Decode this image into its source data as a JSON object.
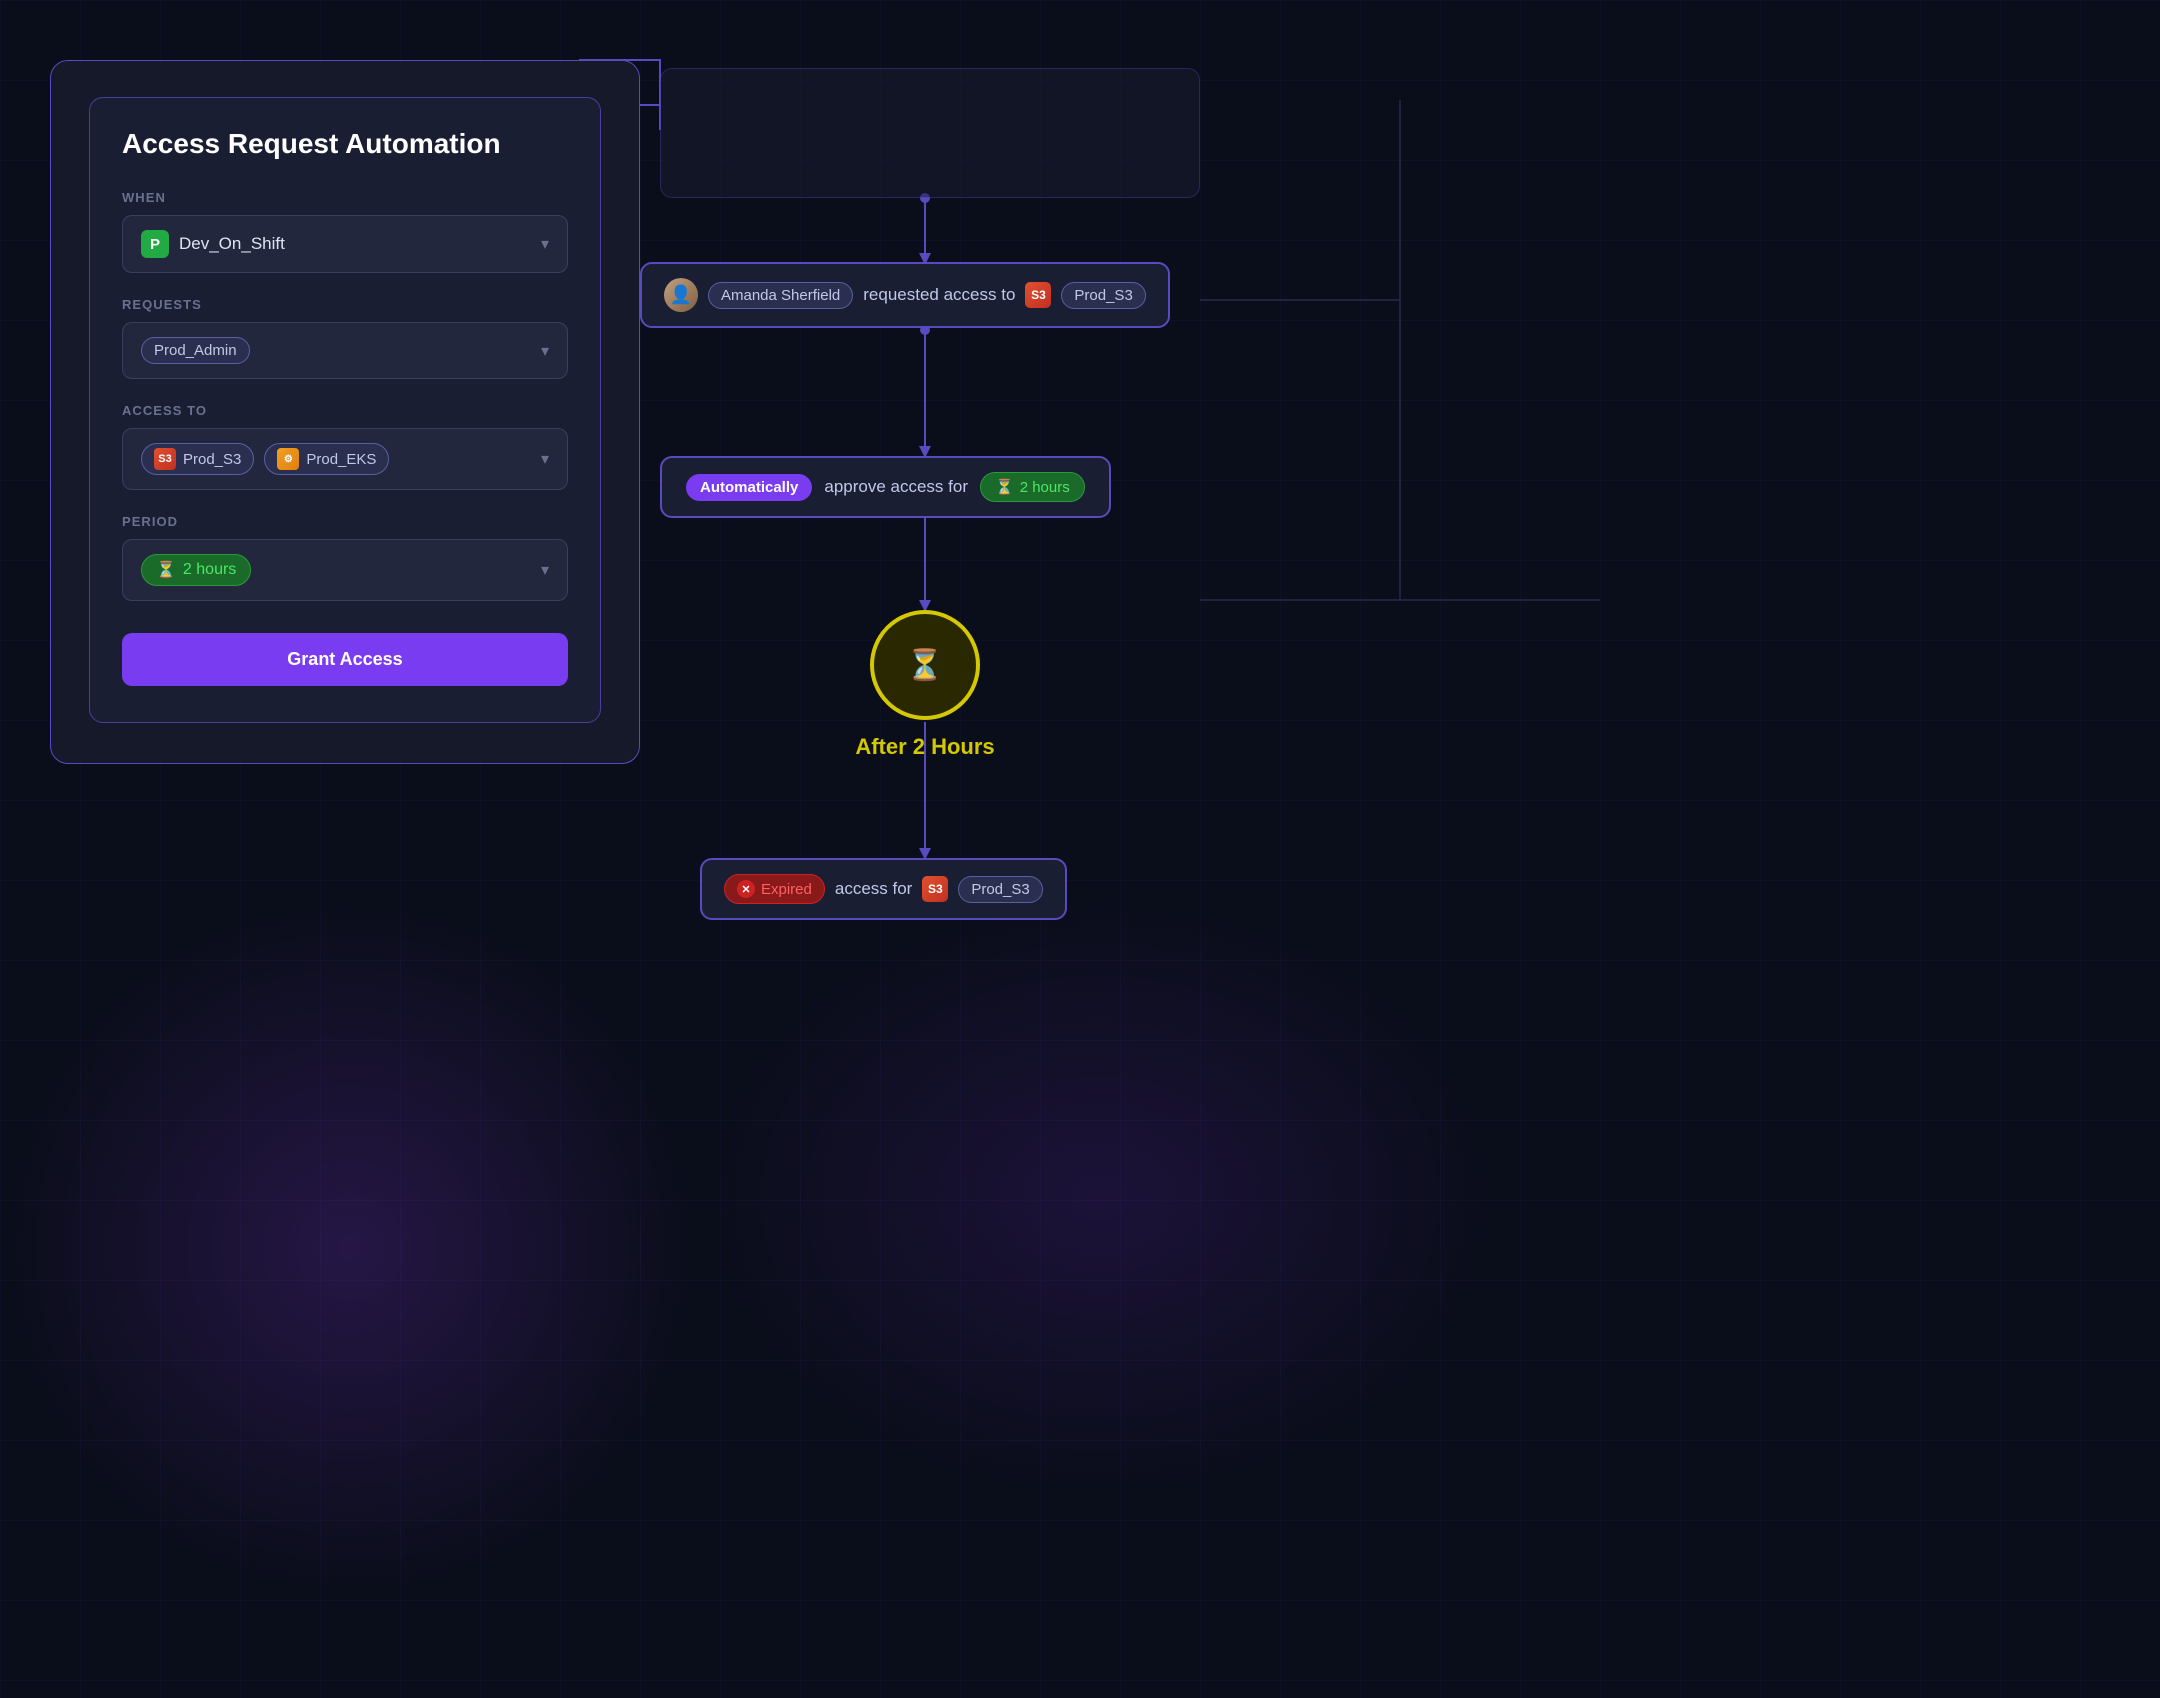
{
  "panel": {
    "title": "Access Request Automation",
    "when_label": "WHEN",
    "when_value": "Dev_On_Shift",
    "requests_label": "REQUESTS",
    "requests_value": "Prod_Admin",
    "access_to_label": "ACCESS TO",
    "access_res1": "Prod_S3",
    "access_res2": "Prod_EKS",
    "period_label": "PERIOD",
    "period_value": "2 hours",
    "grant_btn": "Grant Access"
  },
  "flow": {
    "request_node": {
      "person_name": "Amanda Sherfield",
      "text1": "requested access to",
      "resource": "Prod_S3"
    },
    "auto_node": {
      "badge": "Automatically",
      "text": "approve access for",
      "hours": "2 hours"
    },
    "timer": {
      "label": "After 2 Hours"
    },
    "expired_node": {
      "badge": "Expired",
      "text": "access for",
      "resource": "Prod_S3"
    }
  },
  "icons": {
    "chevron_down": "⌄",
    "hourglass": "⏳",
    "p_letter": "P",
    "x_mark": "✕"
  },
  "colors": {
    "bg": "#0a0d1a",
    "panel_bg": "#161929",
    "panel_inner": "#1a1e32",
    "border": "#5a4abf",
    "accent_purple": "#7a3cf0",
    "green": "#22aa44",
    "green_text": "#4ae864",
    "yellow": "#d4c800",
    "red": "#cc2222",
    "text_primary": "#ffffff",
    "text_secondary": "#c0c8e8",
    "text_muted": "#6a7090"
  }
}
